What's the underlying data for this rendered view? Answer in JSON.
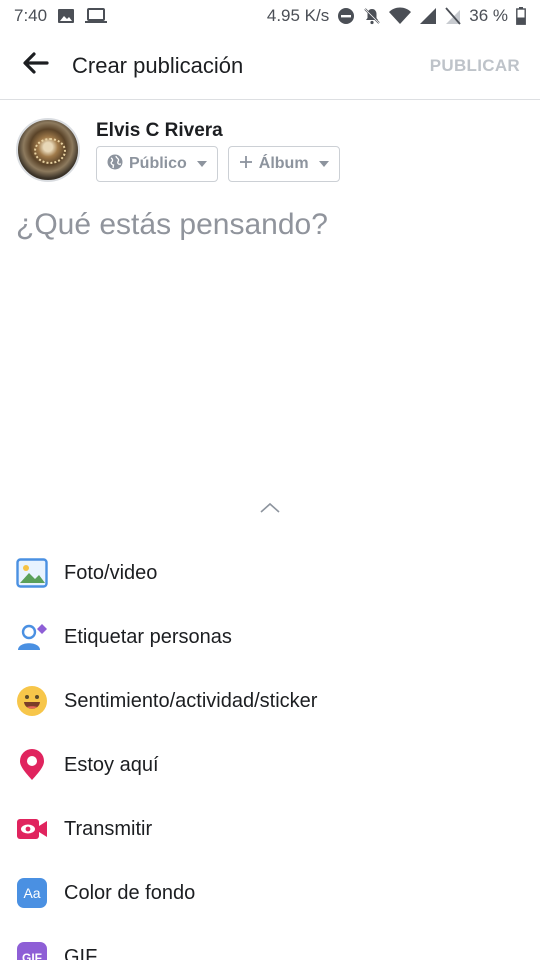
{
  "status_bar": {
    "time": "7:40",
    "net_speed": "4.95 K/s",
    "battery": "36 %",
    "icons": [
      "image-icon",
      "laptop-icon",
      "do-not-disturb-icon",
      "muted-bell-icon",
      "wifi-icon",
      "signal-icon",
      "no-sim-icon",
      "battery-icon"
    ]
  },
  "app_bar": {
    "title": "Crear publicación",
    "publish_label": "PUBLICAR",
    "back_icon": "arrow-left-icon"
  },
  "composer": {
    "user_name": "Elvis C Rivera",
    "privacy_label": "Público",
    "album_label": "Álbum",
    "placeholder": "¿Qué estás pensando?"
  },
  "options": [
    {
      "label": "Foto/video",
      "icon": "photo-icon"
    },
    {
      "label": "Etiquetar personas",
      "icon": "tag-people-icon"
    },
    {
      "label": "Sentimiento/actividad/sticker",
      "icon": "smiley-icon"
    },
    {
      "label": "Estoy aquí",
      "icon": "location-pin-icon"
    },
    {
      "label": "Transmitir",
      "icon": "live-video-icon"
    },
    {
      "label": "Color de fondo",
      "icon": "background-color-icon"
    },
    {
      "label": "GIF",
      "icon": "gif-icon"
    }
  ],
  "colors": {
    "publish_disabled": "#bec3c9",
    "placeholder": "#90949c",
    "icon_blue": "#4a90e2",
    "icon_red": "#e0245e"
  }
}
